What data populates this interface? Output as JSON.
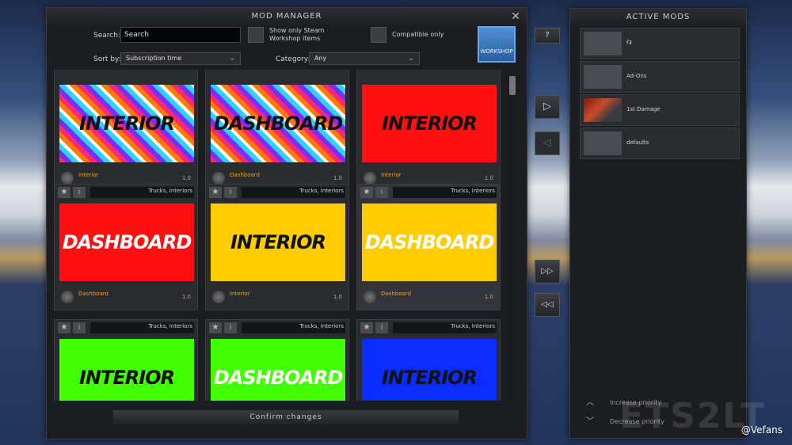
{
  "colors": {
    "thumb_red": "#ff1010",
    "thumb_yellow": "#ffcc00",
    "thumb_green": "#44ff00",
    "thumb_blue": "#0a2cff",
    "mod_name": "#f2a019",
    "panel": "#1c1d20"
  },
  "dialog": {
    "title": "MOD MANAGER",
    "close_icon": "✕",
    "search_label": "Search:",
    "search_value": "Search",
    "filter_workshop_label": "Show only Steam Workshop items",
    "filter_compatible_label": "Compatible only",
    "workshop_button_label": "WORKSHOP",
    "sort_label": "Sort by:",
    "sort_value": "Subscription time",
    "category_label": "Category:",
    "category_value": "Any",
    "confirm_label": "Confirm changes"
  },
  "mods": [
    {
      "title": "INTERIOR",
      "thumb": "multicolor",
      "text_color": "#111111",
      "name": "Interior",
      "version": "1.0",
      "category": ""
    },
    {
      "title": "DASHBOARD",
      "thumb": "multicolor",
      "text_color": "#111111",
      "name": "Dashboard",
      "version": "1.0",
      "category": ""
    },
    {
      "title": "INTERIOR",
      "thumb": "red",
      "text_color": "#111111",
      "name": "Interior",
      "version": "1.0",
      "category": ""
    },
    {
      "title": "DASHBOARD",
      "thumb": "red",
      "text_color": "#ffffff",
      "name": "Dashboard",
      "version": "1.0",
      "category": "Trucks, Interiors"
    },
    {
      "title": "INTERIOR",
      "thumb": "yellow",
      "text_color": "#111111",
      "name": "Interior",
      "version": "1.0",
      "category": "Trucks, Interiors"
    },
    {
      "title": "DASHBOARD",
      "thumb": "yellow",
      "text_color": "#ffffff",
      "name": "Dashboard",
      "version": "1.0",
      "category": "Trucks, Interiors"
    },
    {
      "title": "INTERIOR",
      "thumb": "green",
      "text_color": "#111111",
      "name": "",
      "version": "",
      "category": "Trucks, Interiors"
    },
    {
      "title": "DASHBOARD",
      "thumb": "green",
      "text_color": "#ffffff",
      "name": "",
      "version": "",
      "category": "Trucks, Interiors"
    },
    {
      "title": "INTERIOR",
      "thumb": "blue",
      "text_color": "#111111",
      "name": "",
      "version": "",
      "category": "Trucks, Interiors"
    }
  ],
  "active_panel": {
    "title": "ACTIVE MODS",
    "mods": [
      {
        "label": "f3"
      },
      {
        "label": "Ad-Ons"
      },
      {
        "label": "1st Damage"
      },
      {
        "label": "defaults"
      }
    ],
    "increase_label": "Increase priority",
    "decrease_label": "Decrease priority",
    "up_icon": "︿",
    "down_icon": "﹀"
  },
  "transfer": {
    "help": "?",
    "add_icon": "▷",
    "remove_icon": "◁",
    "add_all_icon": "▷▷",
    "remove_all_icon": "◁◁"
  },
  "watermark": "ETS2LT",
  "credit": "@Vefans"
}
